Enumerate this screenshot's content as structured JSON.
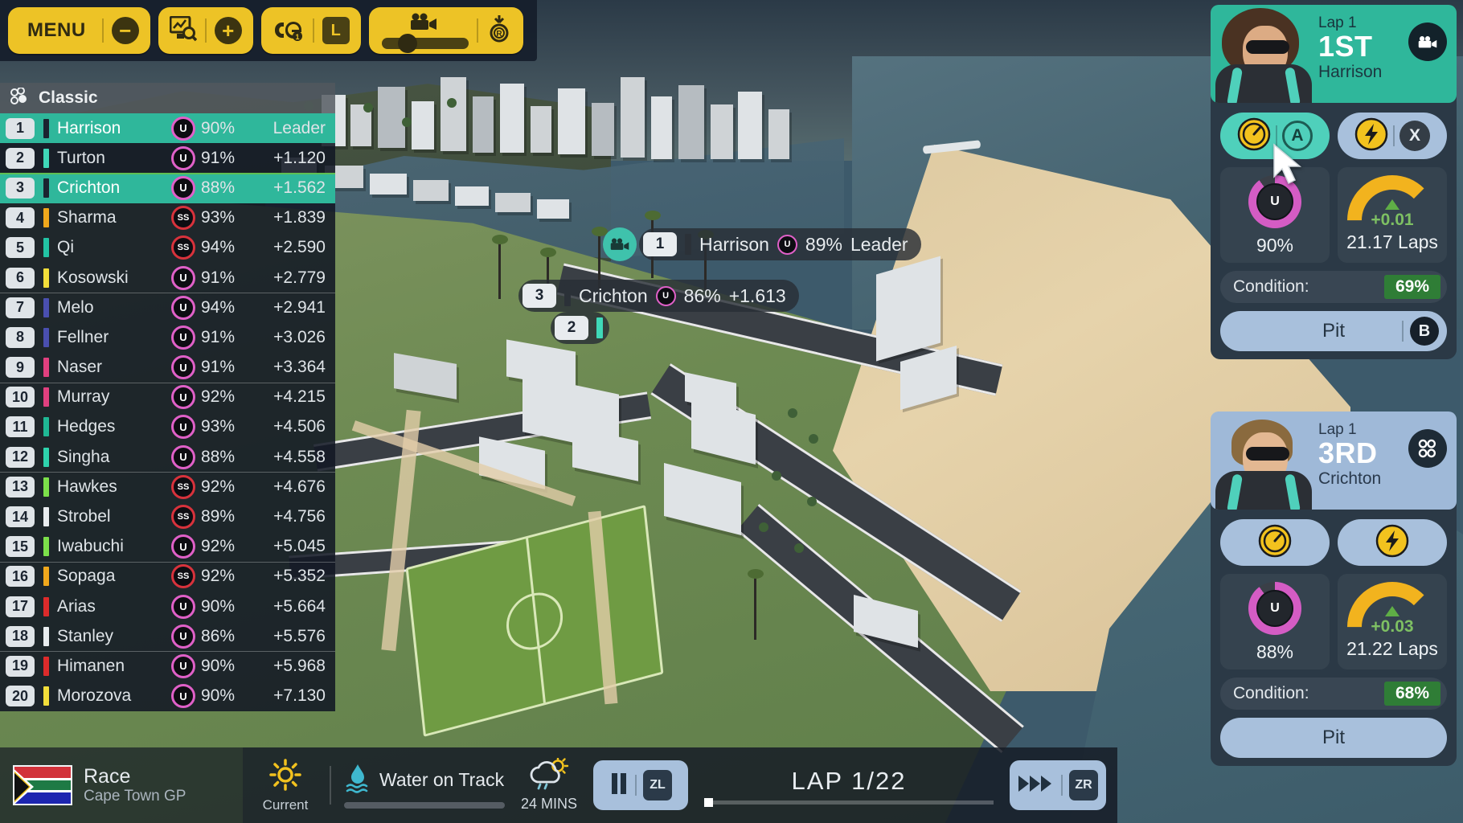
{
  "toolbar": {
    "menu_label": "MENU",
    "groups": [
      {
        "name": "menu-group",
        "items": [
          {
            "icon": "menu-label",
            "label": "MENU"
          },
          {
            "icon": "minus-icon",
            "label": "−"
          }
        ]
      },
      {
        "name": "telemetry-group",
        "items": [
          {
            "icon": "chart-search-icon",
            "label": ""
          },
          {
            "icon": "plus-icon",
            "label": "+"
          }
        ]
      },
      {
        "name": "strategy-group",
        "items": [
          {
            "icon": "helmets-icon",
            "label": ""
          },
          {
            "icon": "l-key-icon",
            "label": "L"
          }
        ]
      },
      {
        "name": "camera-group",
        "items": [
          {
            "icon": "camera-icon",
            "label": ""
          },
          {
            "icon": "replay-icon",
            "label": "R"
          }
        ]
      }
    ]
  },
  "standings": {
    "header_title": "Classic",
    "header_icon": "tyre-cluster-icon",
    "columns": [
      "pos",
      "driver",
      "tyre",
      "wear",
      "gap"
    ],
    "rows": [
      {
        "pos": "1",
        "driver": "Harrison",
        "team_color": "#1b2430",
        "tyre": "U",
        "tyre_color": "#e060c8",
        "wear": "90%",
        "gap": "Leader",
        "highlight": true
      },
      {
        "pos": "2",
        "driver": "Turton",
        "team_color": "#3fd8b8",
        "tyre": "U",
        "tyre_color": "#e060c8",
        "wear": "91%",
        "gap": "+1.120",
        "highlight": false
      },
      {
        "pos": "3",
        "driver": "Crichton",
        "team_color": "#1b2430",
        "tyre": "U",
        "tyre_color": "#e060c8",
        "wear": "88%",
        "gap": "+1.562",
        "highlight": true,
        "sep_top": true
      },
      {
        "pos": "4",
        "driver": "Sharma",
        "team_color": "#f0a81c",
        "tyre": "SS",
        "tyre_color": "#d8323c",
        "wear": "93%",
        "gap": "+1.839",
        "highlight": false
      },
      {
        "pos": "5",
        "driver": "Qi",
        "team_color": "#22c3a4",
        "tyre": "SS",
        "tyre_color": "#d8323c",
        "wear": "94%",
        "gap": "+2.590",
        "highlight": false
      },
      {
        "pos": "6",
        "driver": "Kosowski",
        "team_color": "#f2de3a",
        "tyre": "U",
        "tyre_color": "#e060c8",
        "wear": "91%",
        "gap": "+2.779",
        "highlight": false
      },
      {
        "pos": "7",
        "driver": "Melo",
        "team_color": "#4a4fb0",
        "tyre": "U",
        "tyre_color": "#e060c8",
        "wear": "94%",
        "gap": "+2.941",
        "highlight": false,
        "divider": true
      },
      {
        "pos": "8",
        "driver": "Fellner",
        "team_color": "#4a4fb0",
        "tyre": "U",
        "tyre_color": "#e060c8",
        "wear": "91%",
        "gap": "+3.026",
        "highlight": false
      },
      {
        "pos": "9",
        "driver": "Naser",
        "team_color": "#e0407f",
        "tyre": "U",
        "tyre_color": "#e060c8",
        "wear": "91%",
        "gap": "+3.364",
        "highlight": false
      },
      {
        "pos": "10",
        "driver": "Murray",
        "team_color": "#e0407f",
        "tyre": "U",
        "tyre_color": "#e060c8",
        "wear": "92%",
        "gap": "+4.215",
        "highlight": false,
        "divider": true
      },
      {
        "pos": "11",
        "driver": "Hedges",
        "team_color": "#1fb894",
        "tyre": "U",
        "tyre_color": "#e060c8",
        "wear": "93%",
        "gap": "+4.506",
        "highlight": false
      },
      {
        "pos": "12",
        "driver": "Singha",
        "team_color": "#2ed3ad",
        "tyre": "U",
        "tyre_color": "#e060c8",
        "wear": "88%",
        "gap": "+4.558",
        "highlight": false
      },
      {
        "pos": "13",
        "driver": "Hawkes",
        "team_color": "#7ce04a",
        "tyre": "SS",
        "tyre_color": "#d8323c",
        "wear": "92%",
        "gap": "+4.676",
        "highlight": false,
        "divider": true
      },
      {
        "pos": "14",
        "driver": "Strobel",
        "team_color": "#e8ecef",
        "tyre": "SS",
        "tyre_color": "#d8323c",
        "wear": "89%",
        "gap": "+4.756",
        "highlight": false
      },
      {
        "pos": "15",
        "driver": "Iwabuchi",
        "team_color": "#7ce04a",
        "tyre": "U",
        "tyre_color": "#e060c8",
        "wear": "92%",
        "gap": "+5.045",
        "highlight": false
      },
      {
        "pos": "16",
        "driver": "Sopaga",
        "team_color": "#f0a81c",
        "tyre": "SS",
        "tyre_color": "#d8323c",
        "wear": "92%",
        "gap": "+5.352",
        "highlight": false,
        "divider": true
      },
      {
        "pos": "17",
        "driver": "Arias",
        "team_color": "#dd2b2b",
        "tyre": "U",
        "tyre_color": "#e060c8",
        "wear": "90%",
        "gap": "+5.664",
        "highlight": false
      },
      {
        "pos": "18",
        "driver": "Stanley",
        "team_color": "#e8ecef",
        "tyre": "U",
        "tyre_color": "#e060c8",
        "wear": "86%",
        "gap": "+5.576",
        "highlight": false
      },
      {
        "pos": "19",
        "driver": "Himanen",
        "team_color": "#dd2b2b",
        "tyre": "U",
        "tyre_color": "#e060c8",
        "wear": "90%",
        "gap": "+5.968",
        "highlight": false,
        "divider": true
      },
      {
        "pos": "20",
        "driver": "Morozova",
        "team_color": "#f2de3a",
        "tyre": "U",
        "tyre_color": "#e060c8",
        "wear": "90%",
        "gap": "+7.130",
        "highlight": false
      }
    ]
  },
  "world_labels": [
    {
      "pos": "1",
      "driver": "Harrison",
      "tyre": "U",
      "wear": "89%",
      "gap": "Leader",
      "team_color": "#2b3138",
      "camera": true
    },
    {
      "pos": "3",
      "driver": "Crichton",
      "tyre": "U",
      "wear": "86%",
      "gap": "+1.613",
      "team_color": "#2b3138",
      "camera": false
    },
    {
      "pos": "2",
      "driver": "",
      "tyre": "",
      "wear": "",
      "gap": "",
      "team_color": "#3fd8b8",
      "camera": false
    }
  ],
  "driver_cards": [
    {
      "lap": "Lap 1",
      "position": "1ST",
      "name": "Harrison",
      "badge_icon": "camera-icon",
      "theme": "teal",
      "pace_button": {
        "icon": "speedometer-icon",
        "key": "A",
        "active": true
      },
      "boost_button": {
        "icon": "lightning-icon",
        "key": "X",
        "active": false
      },
      "tyre": {
        "label": "U",
        "wear": "90%",
        "ring_color": "#d45cc4"
      },
      "fuel": {
        "delta": "+0.01",
        "laps": "21.17 Laps",
        "trend": "up"
      },
      "condition_label": "Condition:",
      "condition_value": "69%",
      "pit_label": "Pit",
      "pit_key": "B"
    },
    {
      "lap": "Lap 1",
      "position": "3RD",
      "name": "Crichton",
      "badge_icon": "tyre-cluster-icon",
      "theme": "blue",
      "pace_button": {
        "icon": "speedometer-icon",
        "key": "",
        "active": false
      },
      "boost_button": {
        "icon": "lightning-icon",
        "key": "",
        "active": false
      },
      "tyre": {
        "label": "U",
        "wear": "88%",
        "ring_color": "#d45cc4"
      },
      "fuel": {
        "delta": "+0.03",
        "laps": "21.22 Laps",
        "trend": "up"
      },
      "condition_label": "Condition:",
      "condition_value": "68%",
      "pit_label": "Pit",
      "pit_key": ""
    }
  ],
  "bottom_bar": {
    "flag": "south-africa-flag",
    "session_type": "Race",
    "event_name": "Cape Town GP",
    "weather_current": {
      "icon": "sun-icon",
      "caption": "Current"
    },
    "water_on_track": {
      "icon": "water-icon",
      "label": "Water on Track",
      "level_pct": 0
    },
    "weather_forecast": {
      "icon": "rain-cloud-icon",
      "caption": "24 MINS"
    },
    "pause_button": {
      "icon": "pause-icon",
      "key": "ZL"
    },
    "lap_text": "LAP 1/22",
    "lap_progress_pct": 2,
    "fast_forward_button": {
      "icon": "fast-forward-icon",
      "key": "ZR"
    }
  },
  "colors": {
    "accent_teal": "#2fb79b",
    "accent_blue": "#a8c0dc",
    "accent_yellow": "#edc326",
    "panel_dark": "#2b3946",
    "green_good": "#2f7d36"
  }
}
